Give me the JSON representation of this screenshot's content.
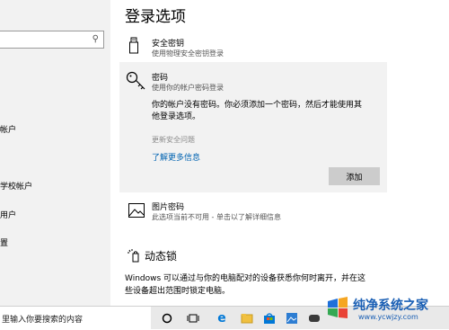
{
  "left": {
    "search_icon": "search-icon",
    "nav_items": [
      "帐户",
      "学校帐户",
      "用户",
      "置"
    ]
  },
  "main": {
    "title": "登录选项",
    "security_key": {
      "title": "安全密钥",
      "subtitle": "使用物理安全密钥登录",
      "icon": "usb-key-icon"
    },
    "password": {
      "title": "密码",
      "subtitle": "使用你的帐户密码登录",
      "icon": "key-icon",
      "desc_line1": "你的帐户没有密码。你必须添加一个密码，然后才能使用其",
      "desc_line2": "他登录选项。",
      "update_security": "更新安全问题",
      "learn_more": "了解更多信息",
      "add_button": "添加"
    },
    "picture_password": {
      "title": "图片密码",
      "subtitle": "此选项当前不可用 - 单击以了解详细信息",
      "icon": "picture-icon"
    },
    "dynamic_lock": {
      "title": "动态锁",
      "icon": "dynamic-lock-icon",
      "desc_line1": "Windows 可以通过与你的电脑配对的设备获悉你何时离开，并在这",
      "desc_line2": "些设备超出范围时锁定电脑。"
    }
  },
  "taskbar": {
    "search_text": "里输入你要搜索的内容",
    "icons": [
      "cortana-icon",
      "task-view-icon",
      "edge-icon",
      "explorer-icon",
      "store-icon",
      "photos-icon",
      "game-icon"
    ]
  },
  "watermark": {
    "brand": "纯净系统之家",
    "url": "www.ycwjzy.com"
  },
  "colors": {
    "link": "#0063b1",
    "panel": "#f2f2f2",
    "button": "#cccccc"
  }
}
